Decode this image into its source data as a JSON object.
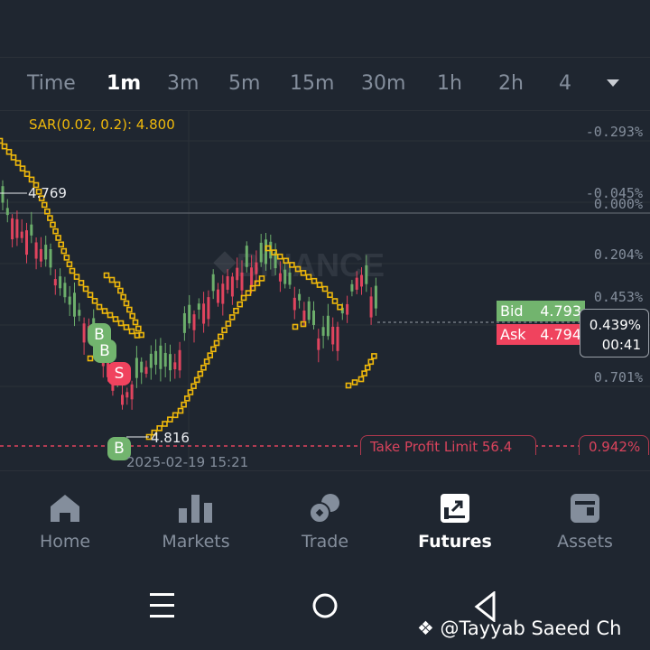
{
  "intervals": [
    {
      "label": "Time"
    },
    {
      "label": "1m",
      "active": true
    },
    {
      "label": "3m"
    },
    {
      "label": "5m"
    },
    {
      "label": "15m"
    },
    {
      "label": "30m"
    },
    {
      "label": "1h"
    },
    {
      "label": "2h"
    },
    {
      "label": "4"
    }
  ],
  "indicator": "SAR(0.02, 0.2): 4.800",
  "axis": [
    "-0.293%",
    "-0.045%",
    "0.000%",
    "0.204%",
    "0.453%",
    "0.701%",
    "0.942%"
  ],
  "high_label": "4.769",
  "low_label": "4.816",
  "bid": {
    "label": "Bid",
    "value": "4.793"
  },
  "ask": {
    "label": "Ask",
    "value": "4.794"
  },
  "current": {
    "percent": "0.439%",
    "countdown": "00:41"
  },
  "take_profit": "Take Profit Limit  56.4",
  "crosshair_date": "2025-02-19 15:21",
  "watermark_logo": "BINANCE",
  "markers": [
    {
      "label": "B"
    },
    {
      "label": "B"
    },
    {
      "label": "S"
    },
    {
      "label": "B"
    }
  ],
  "colors": {
    "up": "#6cae6b",
    "down": "#e0445e",
    "sar": "#f0b90b",
    "bid": "#72b46e",
    "ask": "#f0435e"
  },
  "nav": [
    {
      "label": "Home"
    },
    {
      "label": "Markets"
    },
    {
      "label": "Trade"
    },
    {
      "label": "Futures",
      "active": true
    },
    {
      "label": "Assets"
    }
  ],
  "credit": "@Tayyab Saeed Ch"
}
